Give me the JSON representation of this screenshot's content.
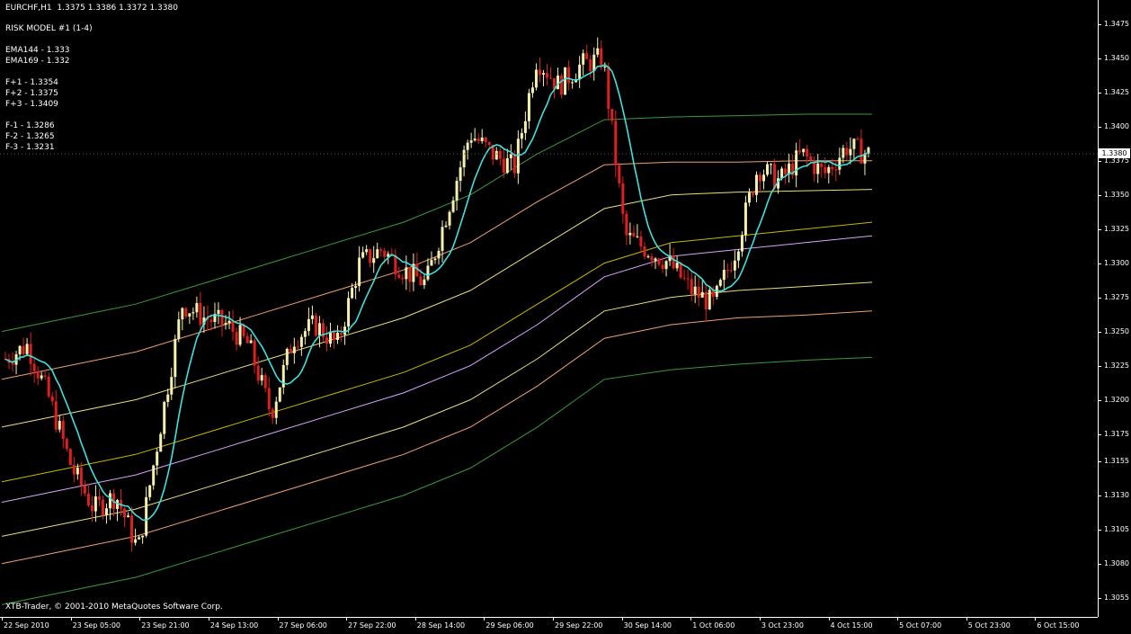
{
  "window": {
    "symbol_line": "EURCHF,H1  1.3375 1.3386 1.3372 1.3380",
    "model_line": "RISK MODEL #1 (1-4)",
    "ema_lines": [
      "EMA144 - 1.333",
      "EMA169 - 1.332"
    ],
    "fplus_lines": [
      "F+1 - 1.3354",
      "F+2 - 1.3375",
      "F+3 - 1.3409"
    ],
    "fminus_lines": [
      "F-1 - 1.3286",
      "F-2 - 1.3265",
      "F-3 - 1.3231"
    ],
    "copyright": "XTB-Trader, © 2001-2010 MetaQuotes Software Corp.",
    "current_price": "1.3380"
  },
  "price_axis": {
    "labels": [
      "1.3475",
      "1.3450",
      "1.3425",
      "1.3400",
      "1.3375",
      "1.3350",
      "1.3325",
      "1.3300",
      "1.3275",
      "1.3250",
      "1.3225",
      "1.3200",
      "1.3175",
      "1.3155",
      "1.3130",
      "1.3105",
      "1.3080",
      "1.3055"
    ]
  },
  "time_axis": {
    "labels": [
      "22 Sep 2010",
      "23 Sep 05:00",
      "23 Sep 21:00",
      "24 Sep 13:00",
      "27 Sep 06:00",
      "27 Sep 22:00",
      "28 Sep 14:00",
      "29 Sep 06:00",
      "29 Sep 22:00",
      "30 Sep 14:00",
      "1 Oct 06:00",
      "3 Oct 23:00",
      "4 Oct 15:00",
      "5 Oct 07:00",
      "5 Oct 23:00",
      "6 Oct 15:00"
    ]
  },
  "chart_data": {
    "type": "candlestick",
    "symbol": "EURCHF",
    "timeframe": "H1",
    "ylim": [
      1.3045,
      1.349
    ],
    "x": [
      "22 Sep 2010",
      "23 Sep 05:00",
      "23 Sep 21:00",
      "24 Sep 13:00",
      "27 Sep 06:00",
      "27 Sep 22:00",
      "28 Sep 14:00",
      "29 Sep 06:00",
      "29 Sep 22:00",
      "30 Sep 14:00",
      "1 Oct 06:00",
      "3 Oct 23:00",
      "4 Oct 15:00",
      "5 Oct 07:00",
      "5 Oct 23:00",
      "6 Oct 15:00"
    ],
    "close_path": [
      1.323,
      1.324,
      1.32,
      1.315,
      1.312,
      1.313,
      1.309,
      1.318,
      1.327,
      1.326,
      1.3255,
      1.324,
      1.319,
      1.3245,
      1.3255,
      1.324,
      1.33,
      1.331,
      1.3295,
      1.3285,
      1.334,
      1.3395,
      1.338,
      1.337,
      1.345,
      1.343,
      1.3445,
      1.345,
      1.332,
      1.331,
      1.33,
      1.328,
      1.327,
      1.331,
      1.337,
      1.336,
      1.338,
      1.3365,
      1.3385,
      1.338
    ],
    "series": [
      {
        "name": "EMA144 - 1.333",
        "color": "#c8b800",
        "values": [
          1.314,
          1.315,
          1.316,
          1.3175,
          1.319,
          1.3205,
          1.322,
          1.324,
          1.327,
          1.33,
          1.3315,
          1.332,
          1.3325,
          1.333
        ]
      },
      {
        "name": "EMA169 - 1.332",
        "color": "#d9a3ff",
        "values": [
          1.3125,
          1.3135,
          1.3145,
          1.316,
          1.3175,
          1.319,
          1.3205,
          1.3225,
          1.3255,
          1.329,
          1.3305,
          1.331,
          1.3315,
          1.332
        ]
      },
      {
        "name": "F+1 - 1.3354",
        "color": "#e8e07a",
        "values": [
          1.318,
          1.319,
          1.32,
          1.3215,
          1.323,
          1.3245,
          1.326,
          1.328,
          1.331,
          1.334,
          1.335,
          1.3352,
          1.3353,
          1.3354
        ]
      },
      {
        "name": "F+2 - 1.3375",
        "color": "#f0a070",
        "values": [
          1.3215,
          1.3225,
          1.3235,
          1.325,
          1.3265,
          1.328,
          1.3295,
          1.3315,
          1.3345,
          1.3372,
          1.3374,
          1.3374,
          1.3375,
          1.3375
        ]
      },
      {
        "name": "F+3 - 1.3409",
        "color": "#3a9a3a",
        "values": [
          1.325,
          1.326,
          1.327,
          1.3285,
          1.33,
          1.3315,
          1.333,
          1.335,
          1.338,
          1.3405,
          1.3407,
          1.3408,
          1.3409,
          1.3409
        ]
      },
      {
        "name": "F-1 - 1.3286",
        "color": "#e8e07a",
        "values": [
          1.31,
          1.311,
          1.312,
          1.3135,
          1.315,
          1.3165,
          1.318,
          1.32,
          1.323,
          1.3265,
          1.3275,
          1.328,
          1.3283,
          1.3286
        ]
      },
      {
        "name": "F-2 - 1.3265",
        "color": "#f0a070",
        "values": [
          1.308,
          1.309,
          1.31,
          1.3115,
          1.313,
          1.3145,
          1.316,
          1.318,
          1.321,
          1.3245,
          1.3255,
          1.326,
          1.3262,
          1.3265
        ]
      },
      {
        "name": "F-3 - 1.3231",
        "color": "#3a9a3a",
        "values": [
          1.305,
          1.306,
          1.307,
          1.3085,
          1.31,
          1.3115,
          1.313,
          1.315,
          1.318,
          1.3215,
          1.3222,
          1.3226,
          1.3229,
          1.3231
        ]
      }
    ]
  }
}
